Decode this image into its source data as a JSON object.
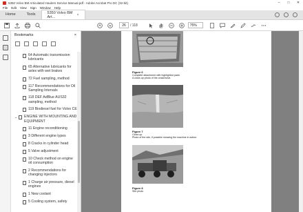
{
  "window": {
    "title": "5350 Volvo BM Articulated Haulers Service Manual.pdf - Adobe Acrobat Pro DC (32-bit)",
    "controls": [
      "–",
      "□",
      "✕"
    ]
  },
  "menu": [
    "File",
    "Edit",
    "View",
    "Sign",
    "Window",
    "Help"
  ],
  "tabs": {
    "home": "Home",
    "tools": "Tools",
    "document": "5350 Volvo BM Art...",
    "close": "×"
  },
  "toolbar": {
    "page_current": "26",
    "page_total": "/ 118",
    "zoom": "75%"
  },
  "bookmarks": {
    "title": "Bookmarks",
    "close": "×",
    "items": [
      {
        "label": "64 Automatic transmission lubricants",
        "level": "sub"
      },
      {
        "label": "65 Alternative lubricants for axles with wet brakes",
        "level": "sub"
      },
      {
        "label": "72 Fuel sampling, method",
        "level": "sub"
      },
      {
        "label": "117 Recommendations for Oil Sampling Intervals",
        "level": "sub"
      },
      {
        "label": "118 DEF AdBlue AUS32 sampling, method",
        "level": "sub"
      },
      {
        "label": "119 Biodiesel fuel for Volvo CE",
        "level": "sub"
      },
      {
        "label": "ENGINE WITH MOUNTING AND EQUIPMENT",
        "level": "top"
      },
      {
        "label": "11 Engine reconditioning",
        "level": "sub"
      },
      {
        "label": "3 Different engine types",
        "level": "sub"
      },
      {
        "label": "8 Cracks in cylinder head",
        "level": "sub"
      },
      {
        "label": "5 Valve adjustment",
        "level": "sub"
      },
      {
        "label": "10 Check method on engine oil consumption",
        "level": "sub"
      },
      {
        "label": "2 Recommendations for changing injectors",
        "level": "sub"
      },
      {
        "label": "1 Charge air pressure, diesel engines",
        "level": "sub"
      },
      {
        "label": "1 New coolant",
        "level": "sub"
      },
      {
        "label": "5 Cooling system, safety",
        "level": "sub"
      }
    ]
  },
  "document": {
    "figures": [
      {
        "title": "Figure 6",
        "text": "Complete attachment with highlighted parts\nA close-up photo of the crack/wear."
      },
      {
        "title": "Figure 7",
        "text": "Close-up\nPhoto of the site, if possible showing the machine in action."
      },
      {
        "title": "Figure 8",
        "text": "Site photo"
      }
    ]
  }
}
